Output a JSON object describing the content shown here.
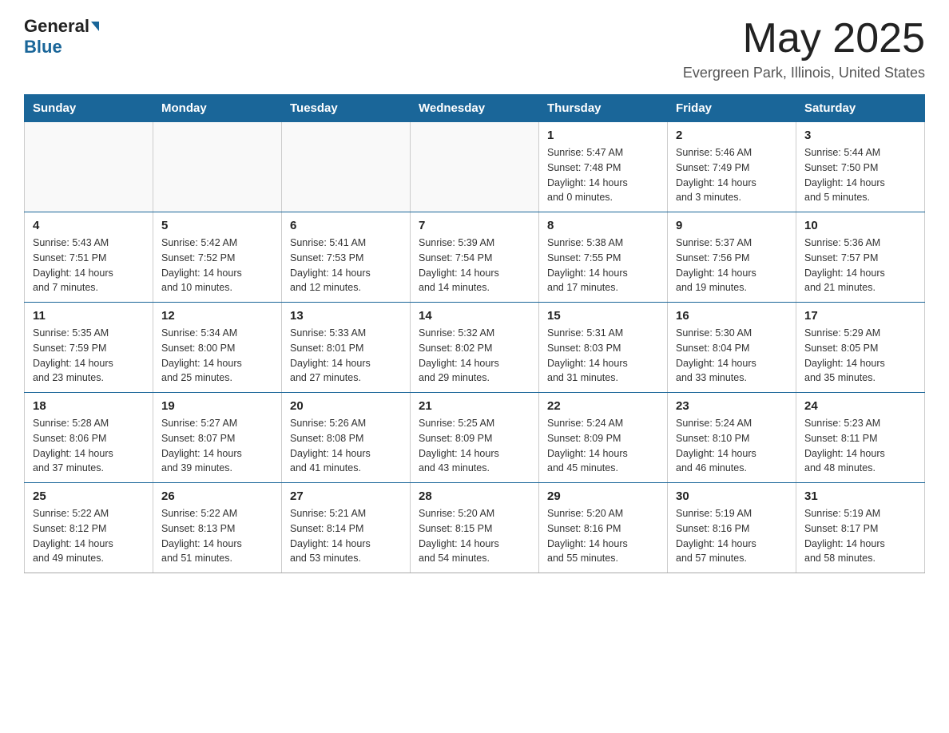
{
  "header": {
    "logo_general": "General",
    "logo_blue": "Blue",
    "month": "May 2025",
    "location": "Evergreen Park, Illinois, United States"
  },
  "days_of_week": [
    "Sunday",
    "Monday",
    "Tuesday",
    "Wednesday",
    "Thursday",
    "Friday",
    "Saturday"
  ],
  "weeks": [
    [
      {
        "day": "",
        "info": ""
      },
      {
        "day": "",
        "info": ""
      },
      {
        "day": "",
        "info": ""
      },
      {
        "day": "",
        "info": ""
      },
      {
        "day": "1",
        "info": "Sunrise: 5:47 AM\nSunset: 7:48 PM\nDaylight: 14 hours\nand 0 minutes."
      },
      {
        "day": "2",
        "info": "Sunrise: 5:46 AM\nSunset: 7:49 PM\nDaylight: 14 hours\nand 3 minutes."
      },
      {
        "day": "3",
        "info": "Sunrise: 5:44 AM\nSunset: 7:50 PM\nDaylight: 14 hours\nand 5 minutes."
      }
    ],
    [
      {
        "day": "4",
        "info": "Sunrise: 5:43 AM\nSunset: 7:51 PM\nDaylight: 14 hours\nand 7 minutes."
      },
      {
        "day": "5",
        "info": "Sunrise: 5:42 AM\nSunset: 7:52 PM\nDaylight: 14 hours\nand 10 minutes."
      },
      {
        "day": "6",
        "info": "Sunrise: 5:41 AM\nSunset: 7:53 PM\nDaylight: 14 hours\nand 12 minutes."
      },
      {
        "day": "7",
        "info": "Sunrise: 5:39 AM\nSunset: 7:54 PM\nDaylight: 14 hours\nand 14 minutes."
      },
      {
        "day": "8",
        "info": "Sunrise: 5:38 AM\nSunset: 7:55 PM\nDaylight: 14 hours\nand 17 minutes."
      },
      {
        "day": "9",
        "info": "Sunrise: 5:37 AM\nSunset: 7:56 PM\nDaylight: 14 hours\nand 19 minutes."
      },
      {
        "day": "10",
        "info": "Sunrise: 5:36 AM\nSunset: 7:57 PM\nDaylight: 14 hours\nand 21 minutes."
      }
    ],
    [
      {
        "day": "11",
        "info": "Sunrise: 5:35 AM\nSunset: 7:59 PM\nDaylight: 14 hours\nand 23 minutes."
      },
      {
        "day": "12",
        "info": "Sunrise: 5:34 AM\nSunset: 8:00 PM\nDaylight: 14 hours\nand 25 minutes."
      },
      {
        "day": "13",
        "info": "Sunrise: 5:33 AM\nSunset: 8:01 PM\nDaylight: 14 hours\nand 27 minutes."
      },
      {
        "day": "14",
        "info": "Sunrise: 5:32 AM\nSunset: 8:02 PM\nDaylight: 14 hours\nand 29 minutes."
      },
      {
        "day": "15",
        "info": "Sunrise: 5:31 AM\nSunset: 8:03 PM\nDaylight: 14 hours\nand 31 minutes."
      },
      {
        "day": "16",
        "info": "Sunrise: 5:30 AM\nSunset: 8:04 PM\nDaylight: 14 hours\nand 33 minutes."
      },
      {
        "day": "17",
        "info": "Sunrise: 5:29 AM\nSunset: 8:05 PM\nDaylight: 14 hours\nand 35 minutes."
      }
    ],
    [
      {
        "day": "18",
        "info": "Sunrise: 5:28 AM\nSunset: 8:06 PM\nDaylight: 14 hours\nand 37 minutes."
      },
      {
        "day": "19",
        "info": "Sunrise: 5:27 AM\nSunset: 8:07 PM\nDaylight: 14 hours\nand 39 minutes."
      },
      {
        "day": "20",
        "info": "Sunrise: 5:26 AM\nSunset: 8:08 PM\nDaylight: 14 hours\nand 41 minutes."
      },
      {
        "day": "21",
        "info": "Sunrise: 5:25 AM\nSunset: 8:09 PM\nDaylight: 14 hours\nand 43 minutes."
      },
      {
        "day": "22",
        "info": "Sunrise: 5:24 AM\nSunset: 8:09 PM\nDaylight: 14 hours\nand 45 minutes."
      },
      {
        "day": "23",
        "info": "Sunrise: 5:24 AM\nSunset: 8:10 PM\nDaylight: 14 hours\nand 46 minutes."
      },
      {
        "day": "24",
        "info": "Sunrise: 5:23 AM\nSunset: 8:11 PM\nDaylight: 14 hours\nand 48 minutes."
      }
    ],
    [
      {
        "day": "25",
        "info": "Sunrise: 5:22 AM\nSunset: 8:12 PM\nDaylight: 14 hours\nand 49 minutes."
      },
      {
        "day": "26",
        "info": "Sunrise: 5:22 AM\nSunset: 8:13 PM\nDaylight: 14 hours\nand 51 minutes."
      },
      {
        "day": "27",
        "info": "Sunrise: 5:21 AM\nSunset: 8:14 PM\nDaylight: 14 hours\nand 53 minutes."
      },
      {
        "day": "28",
        "info": "Sunrise: 5:20 AM\nSunset: 8:15 PM\nDaylight: 14 hours\nand 54 minutes."
      },
      {
        "day": "29",
        "info": "Sunrise: 5:20 AM\nSunset: 8:16 PM\nDaylight: 14 hours\nand 55 minutes."
      },
      {
        "day": "30",
        "info": "Sunrise: 5:19 AM\nSunset: 8:16 PM\nDaylight: 14 hours\nand 57 minutes."
      },
      {
        "day": "31",
        "info": "Sunrise: 5:19 AM\nSunset: 8:17 PM\nDaylight: 14 hours\nand 58 minutes."
      }
    ]
  ]
}
